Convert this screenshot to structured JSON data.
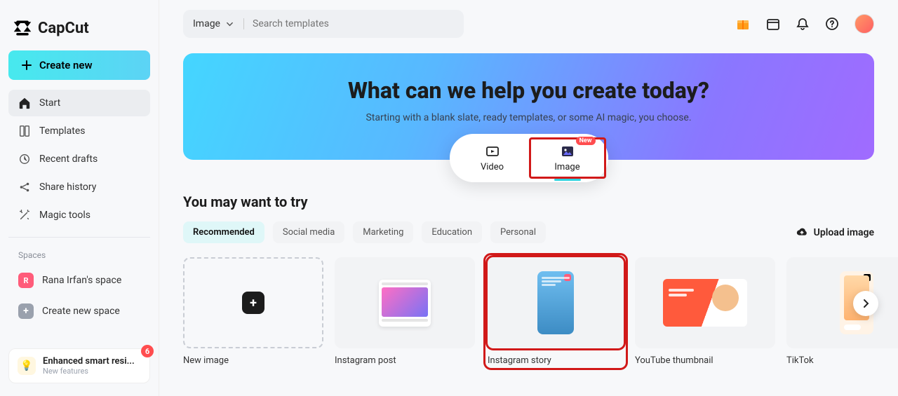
{
  "app_name": "CapCut",
  "create_button": "Create new",
  "nav": [
    "Start",
    "Templates",
    "Recent drafts",
    "Share history",
    "Magic tools"
  ],
  "spaces_label": "Spaces",
  "space_name": "Rana Irfan's space",
  "space_initial": "R",
  "create_space": "Create new space",
  "bottom_card_title": "Enhanced smart resi...",
  "bottom_card_sub": "New features",
  "bottom_card_count": "6",
  "search": {
    "type": "Image",
    "placeholder": "Search templates"
  },
  "hero": {
    "title": "What can we help you create today?",
    "sub": "Starting with a blank slate, ready templates, or some AI magic, you choose."
  },
  "tabs": {
    "video": "Video",
    "image": "Image",
    "badge": "New"
  },
  "section_title": "You may want to try",
  "filters": [
    "Recommended",
    "Social media",
    "Marketing",
    "Education",
    "Personal"
  ],
  "upload_label": "Upload image",
  "cards": [
    "New image",
    "Instagram post",
    "Instagram story",
    "YouTube thumbnail",
    "TikTok"
  ]
}
